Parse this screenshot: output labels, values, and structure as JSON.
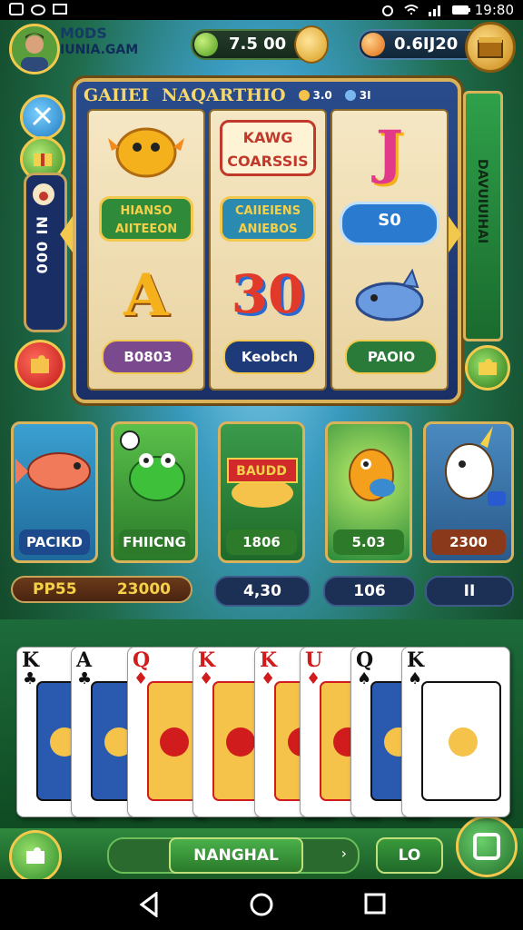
{
  "status": {
    "time": "19:80"
  },
  "header": {
    "player_line1": "M0DS",
    "player_line2": "IUNIA.GAM",
    "coins": "7.5 00",
    "gems": "0.6IJ20"
  },
  "side": {
    "panel_text": "000 IN"
  },
  "slot": {
    "title": "GAIIEI",
    "subtitle": "NAQARTHIO",
    "stat1": "3.0",
    "stat2": "3I",
    "reels": [
      {
        "top": "🐡",
        "logo": "KAWG COARSSIS",
        "mid_label": "HIANSO AIITEEON",
        "bottom": "A",
        "pill": "B0803",
        "pill_color": "#7b4a8e"
      },
      {
        "top": "J",
        "mid_label": "CAIIEIENS ANIEBOS",
        "bottom": "30",
        "pill": "Keobch",
        "pill_color": "#1e3a78"
      },
      {
        "mid_label": "S0",
        "bottom": "🐬",
        "pill": "PAOIO",
        "pill_color": "#2a7a3a"
      }
    ],
    "right_text": "DAVUIUIHAI"
  },
  "cards": [
    {
      "label": "PACIKD",
      "label_color": "#1d4a8c",
      "bg": "#2f7fbf"
    },
    {
      "label": "FHIICNG",
      "label_color": "#2d7a2a",
      "bg": "#3fa03a"
    },
    {
      "label": "1806",
      "label_color": "#2d7a2a",
      "bg": "#2e8a3a",
      "banner": "BAUDD"
    },
    {
      "label": "5.03",
      "label_color": "#2d7a2a",
      "bg": "#3aa64a"
    },
    {
      "label": "2300",
      "label_color": "#8a3a1a",
      "bg": "#3a7aa8"
    }
  ],
  "stats": [
    {
      "label": "PP55",
      "value": "23000"
    },
    {
      "value": "4,30"
    },
    {
      "value": "106"
    },
    {
      "value": "II"
    }
  ],
  "playing_cards": [
    {
      "rank": "K",
      "suit": "♣",
      "color": "#111"
    },
    {
      "rank": "A",
      "suit": "♣",
      "color": "#111"
    },
    {
      "rank": "Q",
      "suit": "♦",
      "color": "#d01c1c"
    },
    {
      "rank": "K",
      "suit": "♦",
      "color": "#d01c1c"
    },
    {
      "rank": "K",
      "suit": "♦",
      "color": "#d01c1c"
    },
    {
      "rank": "U",
      "suit": "♦",
      "color": "#d01c1c"
    },
    {
      "rank": "Q",
      "suit": "♠",
      "color": "#111"
    },
    {
      "rank": "K",
      "suit": "♠",
      "color": "#111"
    }
  ],
  "bottom": {
    "center_label": "NANGHAL",
    "right_label": "LO"
  }
}
